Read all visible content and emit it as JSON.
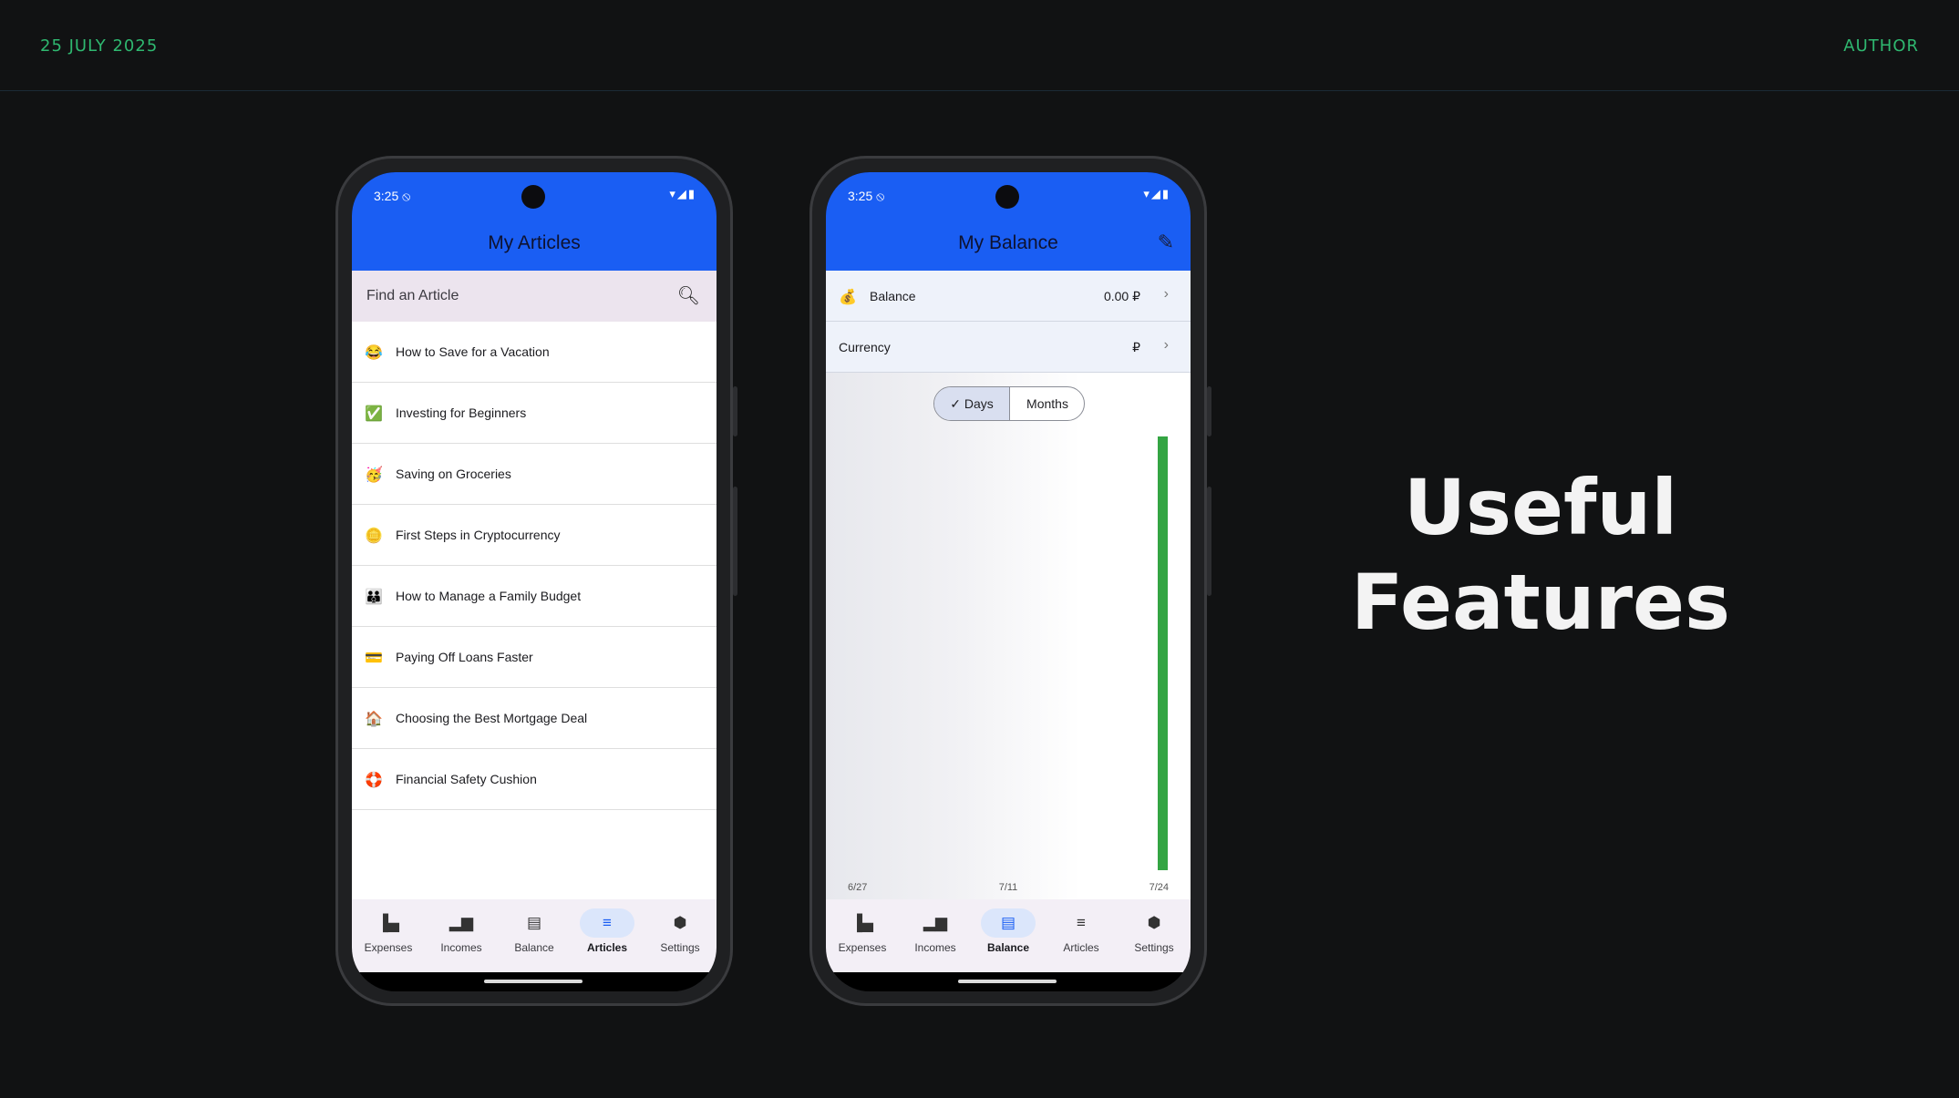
{
  "slide": {
    "date": "25 JULY 2025",
    "author": "AUTHOR",
    "headline_line1": "Useful",
    "headline_line2": "Features"
  },
  "status_bar": {
    "time": "3:25 ⦸",
    "icons": "▾◢▮"
  },
  "articles_screen": {
    "title": "My Articles",
    "search_placeholder": "Find an Article",
    "articles": [
      {
        "emoji": "😂",
        "title": "How to Save for a Vacation"
      },
      {
        "emoji": "✅",
        "title": "Investing for Beginners"
      },
      {
        "emoji": "🥳",
        "title": "Saving on Groceries"
      },
      {
        "emoji": "🪙",
        "title": "First Steps in Cryptocurrency"
      },
      {
        "emoji": "👪",
        "title": "How to Manage a Family Budget"
      },
      {
        "emoji": "💳",
        "title": "Paying Off Loans Faster"
      },
      {
        "emoji": "🏠",
        "title": "Choosing the Best Mortgage Deal"
      },
      {
        "emoji": "🛟",
        "title": "Financial Safety Cushion"
      }
    ]
  },
  "balance_screen": {
    "title": "My Balance",
    "balance_emoji": "💰",
    "balance_label": "Balance",
    "balance_value": "0.00 ₽",
    "currency_label": "Currency",
    "currency_value": "₽",
    "toggle_days": "✓ Days",
    "toggle_months": "Months"
  },
  "nav": {
    "expenses": "Expenses",
    "incomes": "Incomes",
    "balance": "Balance",
    "articles": "Articles",
    "settings": "Settings"
  },
  "colors": {
    "app_bar": "#1a5ef3",
    "accent_green": "#2fb870",
    "bar_green": "#34a543"
  },
  "chart_data": {
    "type": "bar",
    "x": [
      "6/27",
      "7/11",
      "7/24"
    ],
    "categories_count_note": "",
    "bars": [
      {
        "x": "7/24",
        "value": 1
      }
    ],
    "xlabel": "",
    "ylabel": ""
  }
}
